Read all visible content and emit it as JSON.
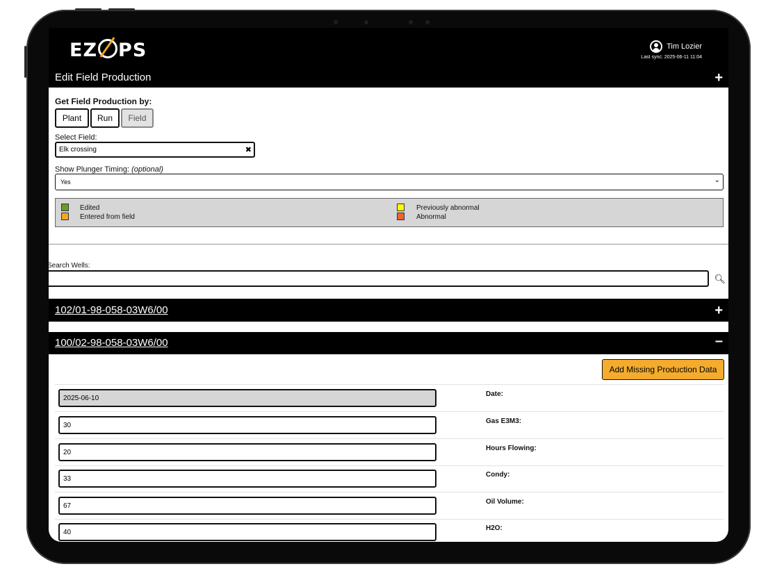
{
  "app": {
    "logo_text_left": "EZ",
    "logo_text_right": "PS"
  },
  "user": {
    "name": "Tim Lozier",
    "last_sync": "Last sync: 2025-06-11 11:04"
  },
  "edit_panel": {
    "title": "Edit Field Production",
    "toggle_icon": "+",
    "get_by_label": "Get Field Production by:",
    "options": [
      "Plant",
      "Run",
      "Field"
    ],
    "selected_option": "Field",
    "select_field_label": "Select Field:",
    "select_field_value": "Elk crossing",
    "clear_icon": "✖",
    "plunger_label": "Show Plunger Timing: ",
    "plunger_optional": "(optional)",
    "plunger_value": "Yes"
  },
  "legend": [
    {
      "label": "Edited",
      "color": "#6d9a2c"
    },
    {
      "label": "Entered from field",
      "color": "#f5a623"
    },
    {
      "label": "Previously abnormal",
      "color": "#ffff00"
    },
    {
      "label": "Abnormal",
      "color": "#f2612e"
    }
  ],
  "search": {
    "label": "Search Wells:",
    "value": "",
    "icon": "search-icon"
  },
  "wells": [
    {
      "id": "102/01-98-058-03W6/00",
      "toggle": "+",
      "expanded": false
    },
    {
      "id": "100/02-98-058-03W6/00",
      "toggle": "–",
      "expanded": true
    }
  ],
  "production": {
    "add_button": "Add Missing Production Data",
    "rows": [
      {
        "label": "Date:",
        "value": "2025-06-10",
        "readonly": true
      },
      {
        "label": "Gas E3M3:",
        "value": "30",
        "readonly": false
      },
      {
        "label": "Hours Flowing:",
        "value": "20",
        "readonly": false
      },
      {
        "label": "Condy:",
        "value": "33",
        "readonly": false
      },
      {
        "label": "Oil Volume:",
        "value": "67",
        "readonly": false
      },
      {
        "label": "H2O:",
        "value": "40",
        "readonly": false
      }
    ]
  }
}
